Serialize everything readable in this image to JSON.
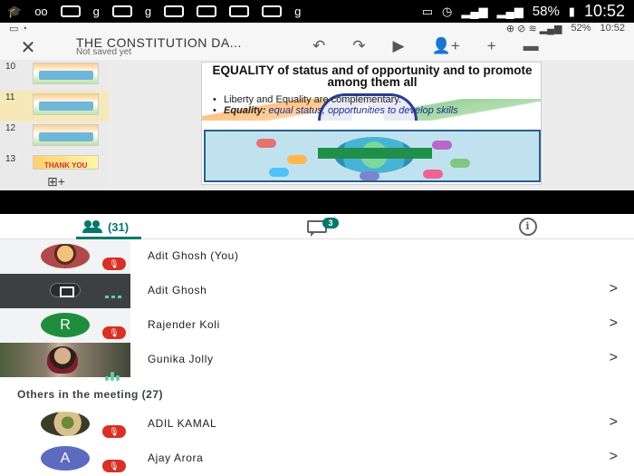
{
  "statusbar": {
    "battery": "58%",
    "time": "10:52"
  },
  "sub_status": {
    "battery": "52%",
    "time": "10:52"
  },
  "slides_toolbar": {
    "title": "THE CONSTITUTION DA...",
    "subtitle": "Not saved yet",
    "icons": [
      "undo-icon",
      "redo-icon",
      "play-icon",
      "add-person-icon",
      "add-icon",
      "comment-icon"
    ]
  },
  "thumbnails": [
    {
      "num": "10",
      "active": false
    },
    {
      "num": "11",
      "active": true
    },
    {
      "num": "12",
      "active": false
    },
    {
      "num": "13",
      "active": false,
      "label": "THANK YOU"
    }
  ],
  "slide": {
    "title": "EQUALITY of status and of opportunity and to promote among them all",
    "bullet1": "Liberty and Equality are complementary.",
    "bullet2_bold": "Equality:",
    "bullet2_rest": " equal status, opportunities to develop skills"
  },
  "tabs": {
    "people_count": "(31)",
    "chat_badge": "3"
  },
  "participants": [
    {
      "name": "Adit Ghosh (You)"
    },
    {
      "name": "Adit Ghosh"
    },
    {
      "name": "Rajender Koli",
      "initial": "R"
    },
    {
      "name": "Gunika Jolly"
    }
  ],
  "others_header": "Others in the meeting (27)",
  "others": [
    {
      "name": "ADIL KAMAL"
    },
    {
      "name": "Ajay Arora",
      "initial": "A"
    }
  ],
  "colors": {
    "accent": "#00796b",
    "mute": "#d93025"
  }
}
